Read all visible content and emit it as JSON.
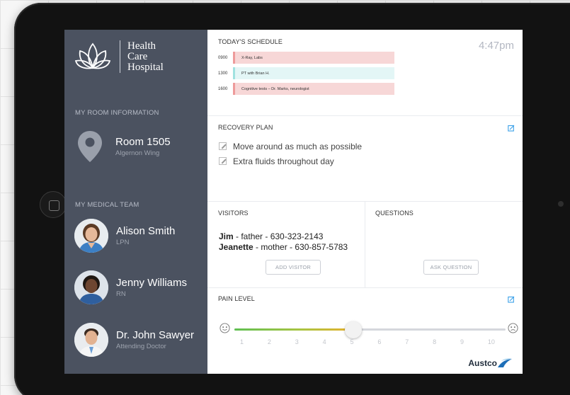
{
  "sidebar": {
    "logo_lines": [
      "Health",
      "Care",
      "Hospital"
    ],
    "room_section": "MY ROOM INFORMATION",
    "room_title": "Room 1505",
    "room_wing": "Algernon Wing",
    "team_section": "MY MEDICAL TEAM",
    "team": [
      {
        "name": "Alison Smith",
        "role": "LPN"
      },
      {
        "name": "Jenny Williams",
        "role": "RN"
      },
      {
        "name": "Dr. John Sawyer",
        "role": "Attending Doctor"
      }
    ]
  },
  "header": {
    "schedule_title": "TODAY'S SCHEDULE",
    "time": "4:47pm"
  },
  "schedule": [
    {
      "time": "0900",
      "text": "X-Ray, Labs",
      "color": "#f7d7d7",
      "accent": "#ee9a9a"
    },
    {
      "time": "1300",
      "text": "PT with Brian H.",
      "color": "#e3f6f6",
      "accent": "#9fe2e0"
    },
    {
      "time": "1600",
      "text": "Cognitive tests  –  Dr. Marks, neurologist",
      "color": "#f7d7d7",
      "accent": "#ee9a9a"
    }
  ],
  "recovery": {
    "title": "RECOVERY PLAN",
    "items": [
      "Move around as much as possible",
      "Extra fluids throughout day"
    ]
  },
  "visitors": {
    "title": "VISITORS",
    "list": [
      {
        "name": "Jim",
        "detail": " - father - 630-323-2143"
      },
      {
        "name": "Jeanette",
        "detail": " - mother - 630-857-5783"
      }
    ],
    "button": "ADD VISITOR"
  },
  "questions": {
    "title": "QUESTIONS",
    "button": "ASK QUESTION"
  },
  "pain": {
    "title": "PAIN LEVEL",
    "value": 5,
    "min": 1,
    "max": 10,
    "labels": [
      "1",
      "2",
      "3",
      "4",
      "5",
      "6",
      "7",
      "8",
      "9",
      "10"
    ]
  },
  "brand": {
    "name": "Austco"
  },
  "colors": {
    "sidebar": "#4b5260",
    "accent_blue": "#3aa0e8"
  }
}
